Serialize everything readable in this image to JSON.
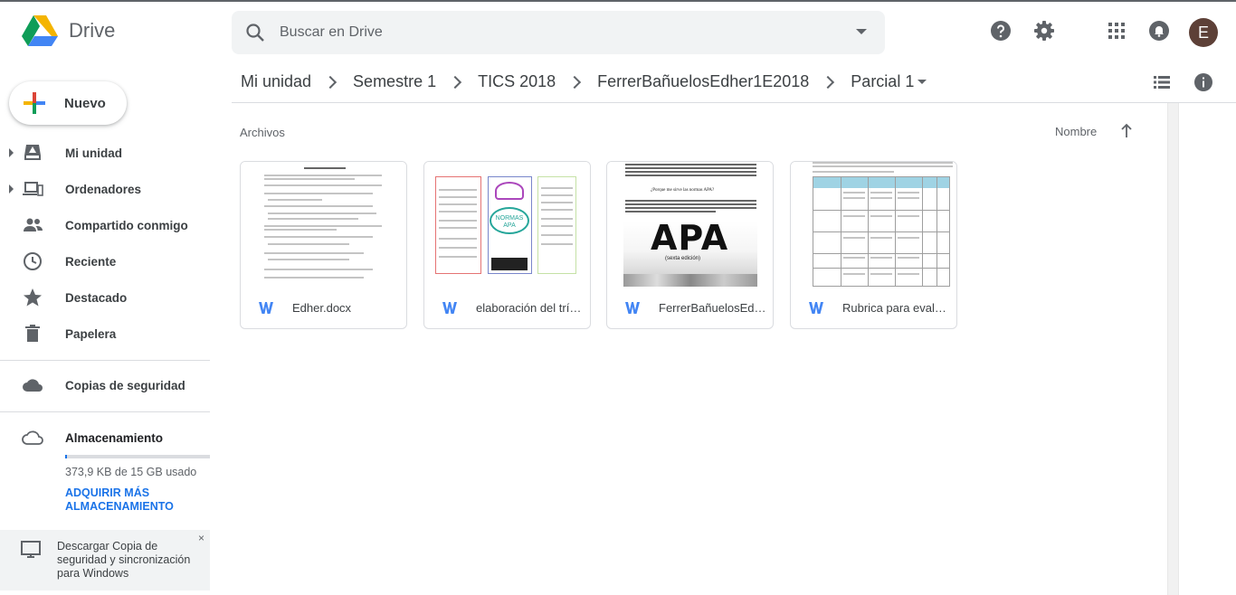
{
  "app": {
    "name": "Drive",
    "colors": {
      "blue": "#1a73e8",
      "green": "#0f9d58",
      "yellow": "#f4b400",
      "red": "#db4437",
      "word_blue": "#4285f4",
      "avatar_bg": "#5d4037"
    }
  },
  "search": {
    "placeholder": "Buscar en Drive",
    "icon": "search-icon"
  },
  "header": {
    "icons": [
      "help-icon",
      "settings-icon",
      "apps-grid-icon",
      "notifications-icon"
    ],
    "avatar_letter": "E"
  },
  "breadcrumb": [
    "Mi unidad",
    "Semestre 1",
    "TICS 2018",
    "FerrerBañuelosEdher1E2018",
    "Parcial 1"
  ],
  "sidebar": {
    "new_label": "Nuevo",
    "items": [
      {
        "label": "Mi unidad",
        "icon": "my-drive-icon"
      },
      {
        "label": "Ordenadores",
        "icon": "computers-icon"
      },
      {
        "label": "Compartido conmigo",
        "icon": "shared-icon"
      },
      {
        "label": "Reciente",
        "icon": "clock-icon"
      },
      {
        "label": "Destacado",
        "icon": "star-icon"
      },
      {
        "label": "Papelera",
        "icon": "trash-icon"
      }
    ],
    "backups_label": "Copias de seguridad",
    "storage_label": "Almacenamiento",
    "storage_used": "373,9 KB de 15 GB usado",
    "storage_fraction": 0.01,
    "buy_storage": "ADQUIRIR MÁS ALMACENAMIENTO",
    "promo": "Descargar Copia de seguridad y sincronización para Windows",
    "promo_close": "×"
  },
  "main": {
    "section_title": "Archivos",
    "sort_label": "Nombre",
    "files": [
      {
        "name": "Edher.docx",
        "type": "word"
      },
      {
        "name": "elaboración del tríptico.docx",
        "type": "word"
      },
      {
        "name": "FerrerBañuelosEdher.docx",
        "type": "word"
      },
      {
        "name": "Rubrica para evaluar.docx",
        "type": "word"
      }
    ],
    "thumb_texts": {
      "apa_big": "APA",
      "apa_caption": "(sexta edición)",
      "apa_heading": "¿Porque me sirve las normas APA?",
      "brochure_title": "NORMAS APA"
    }
  }
}
